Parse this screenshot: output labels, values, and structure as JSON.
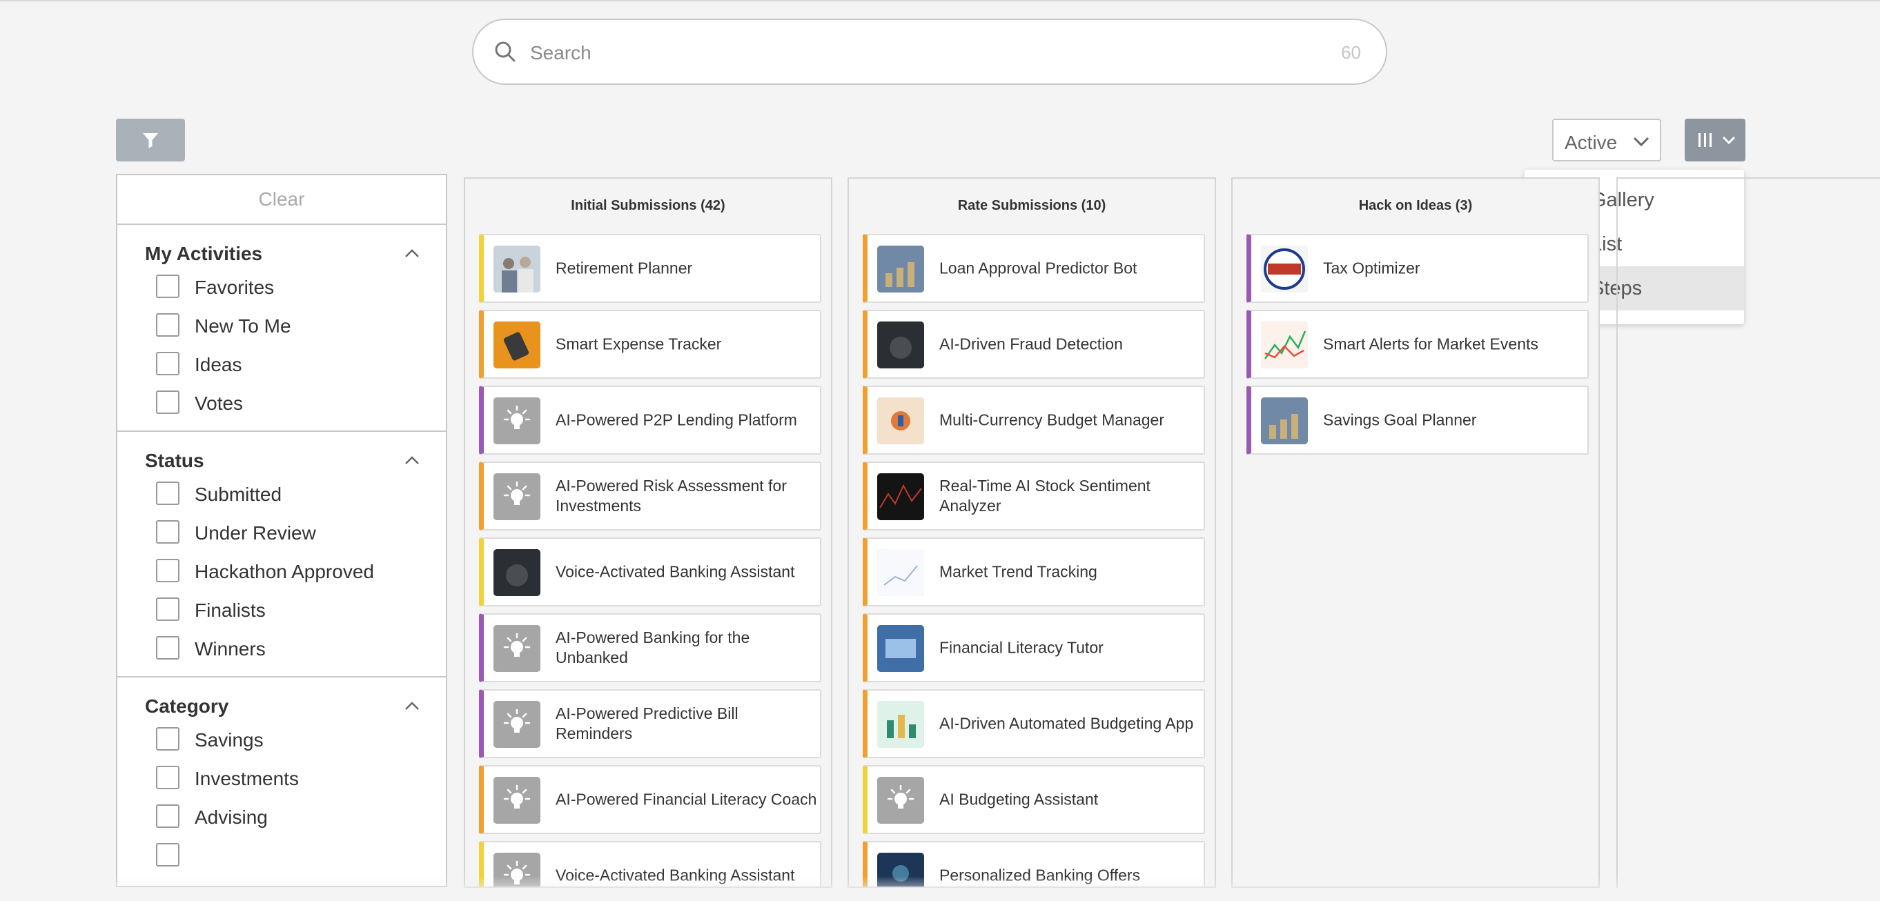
{
  "search": {
    "placeholder": "Search",
    "count": "60"
  },
  "toolbar": {
    "status_value": "Active"
  },
  "view_menu": {
    "options": [
      {
        "label": "Gallery"
      },
      {
        "label": "List"
      },
      {
        "label": "Steps"
      }
    ],
    "selected": "Steps"
  },
  "filters": {
    "clear_label": "Clear",
    "sections": [
      {
        "title": "My Activities",
        "options": [
          "Favorites",
          "New To Me",
          "Ideas",
          "Votes"
        ]
      },
      {
        "title": "Status",
        "options": [
          "Submitted",
          "Under Review",
          "Hackathon Approved",
          "Finalists",
          "Winners"
        ]
      },
      {
        "title": "Category",
        "options": [
          "Savings",
          "Investments",
          "Advising"
        ]
      }
    ]
  },
  "columns": [
    {
      "title": "Initial Submissions (42)",
      "cards": [
        {
          "title": "Retirement Planner",
          "accent": "#f2d23b",
          "thumb": "photo-people-icon"
        },
        {
          "title": "Smart Expense Tracker",
          "accent": "#f0a030",
          "thumb": "photo-orange-icon"
        },
        {
          "title": "AI-Powered P2P Lending Platform",
          "accent": "#9b59b6",
          "thumb": "lightbulb-icon"
        },
        {
          "title": "AI-Powered Risk Assessment for Investments",
          "accent": "#f0a030",
          "thumb": "lightbulb-icon"
        },
        {
          "title": "Voice-Activated Banking Assistant",
          "accent": "#f2d23b",
          "thumb": "photo-dark-icon"
        },
        {
          "title": "AI-Powered Banking for the Unbanked",
          "accent": "#9b59b6",
          "thumb": "lightbulb-icon"
        },
        {
          "title": "AI-Powered Predictive Bill Reminders",
          "accent": "#9b59b6",
          "thumb": "lightbulb-icon"
        },
        {
          "title": "AI-Powered Financial Literacy Coach",
          "accent": "#f0a030",
          "thumb": "lightbulb-icon"
        },
        {
          "title": "Voice-Activated Banking Assistant",
          "accent": "#f2d23b",
          "thumb": "lightbulb-icon"
        }
      ]
    },
    {
      "title": "Rate Submissions (10)",
      "cards": [
        {
          "title": "Loan Approval Predictor Bot",
          "accent": "#f0a030",
          "thumb": "photo-coins-icon"
        },
        {
          "title": "AI-Driven Fraud Detection",
          "accent": "#f0a030",
          "thumb": "photo-dark-icon"
        },
        {
          "title": "Multi-Currency Budget Manager",
          "accent": "#f0a030",
          "thumb": "photo-peach-icon"
        },
        {
          "title": "Real-Time AI Stock Sentiment Analyzer",
          "accent": "#f0a030",
          "thumb": "photo-chart-icon"
        },
        {
          "title": "Market Trend Tracking",
          "accent": "#f0a030",
          "thumb": "photo-light-icon"
        },
        {
          "title": "Financial Literacy Tutor",
          "accent": "#f0a030",
          "thumb": "photo-blue-icon"
        },
        {
          "title": "AI-Driven Automated Budgeting App",
          "accent": "#f0a030",
          "thumb": "photo-mint-icon"
        },
        {
          "title": "AI Budgeting Assistant",
          "accent": "#f2d23b",
          "thumb": "lightbulb-icon"
        },
        {
          "title": "Personalized Banking Offers",
          "accent": "#f0a030",
          "thumb": "photo-navy-icon"
        }
      ]
    },
    {
      "title": "Hack on Ideas (3)",
      "cards": [
        {
          "title": "Tax Optimizer",
          "accent": "#9b59b6",
          "thumb": "tax-day-icon"
        },
        {
          "title": "Smart Alerts for Market Events",
          "accent": "#9b59b6",
          "thumb": "photo-chart-light-icon"
        },
        {
          "title": "Savings Goal Planner",
          "accent": "#9b59b6",
          "thumb": "photo-coins-icon"
        }
      ]
    }
  ],
  "colors": {
    "accent_yellow": "#f2d23b",
    "accent_orange": "#f0a030",
    "accent_purple": "#9b59b6",
    "button_gray": "#aab2b9"
  }
}
